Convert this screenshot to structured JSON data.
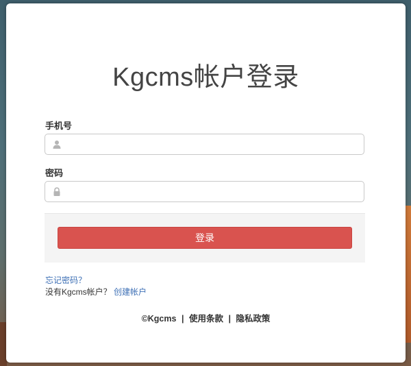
{
  "title": "Kgcms帐户登录",
  "phone": {
    "label": "手机号",
    "placeholder": "",
    "value": "",
    "icon": "user-icon"
  },
  "password": {
    "label": "密码",
    "placeholder": "",
    "value": "",
    "icon": "lock-icon"
  },
  "login_button": "登录",
  "forgot_link": "忘记密码？",
  "no_account_text": "没有Kgcms帐户？",
  "create_link": "创建帐户",
  "footer": {
    "copyright": "©Kgcms",
    "separator": "|",
    "terms": "使用条款",
    "privacy": "隐私政策"
  },
  "colors": {
    "primary_button": "#d9534f",
    "link": "#3d6fb5"
  }
}
